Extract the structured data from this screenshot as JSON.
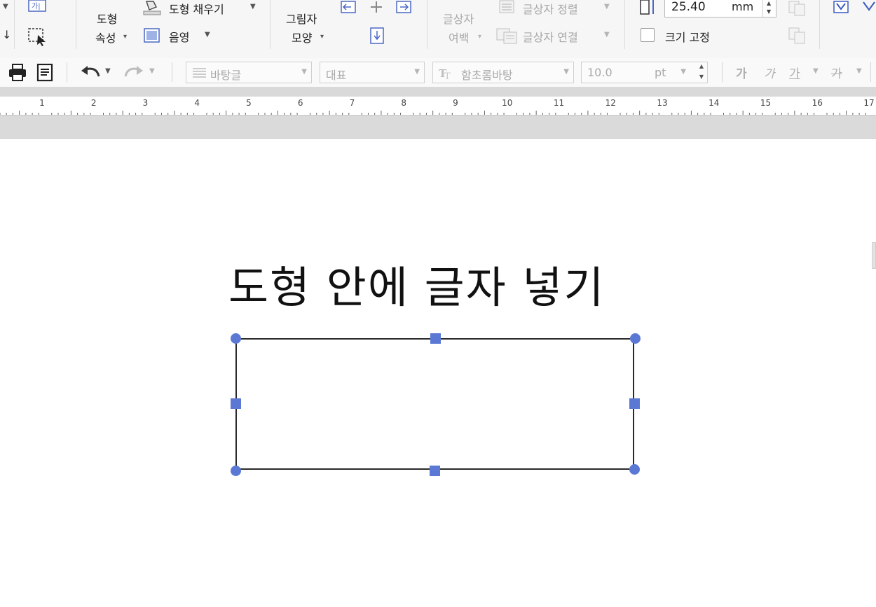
{
  "ribbon": {
    "shape_props_line1": "도형",
    "shape_props_line2": "속성",
    "shape_fill": "도형 채우기",
    "shade": "음영",
    "shadow_shape_line1": "그림자",
    "shadow_shape_line2": "모양",
    "textbox_margin_line1": "글상자",
    "textbox_margin_line2": "여백",
    "textbox_align": "글상자 정렬",
    "textbox_link": "글상자 연결",
    "size_value": "25.40",
    "size_unit": "mm",
    "fix_size": "크기 고정"
  },
  "toolbar": {
    "style_name": "바탕글",
    "lang_group": "대표",
    "font_name": "함초롬바탕",
    "font_size": "10.0",
    "font_unit": "pt",
    "bold_glyph": "가",
    "italic_glyph": "가",
    "underline_glyph": "가",
    "strike_glyph": "가"
  },
  "ruler": {
    "marks": [
      "1",
      "2",
      "3",
      "4",
      "5",
      "6",
      "7",
      "8",
      "9",
      "10",
      "11",
      "12",
      "13",
      "14",
      "15",
      "16",
      "17"
    ]
  },
  "document": {
    "title": "도형 안에 글자 넣기"
  },
  "colors": {
    "handle": "#5b79d4",
    "ribbon_bg": "#f6f6f6",
    "disabled_text": "#a8a8a8"
  }
}
